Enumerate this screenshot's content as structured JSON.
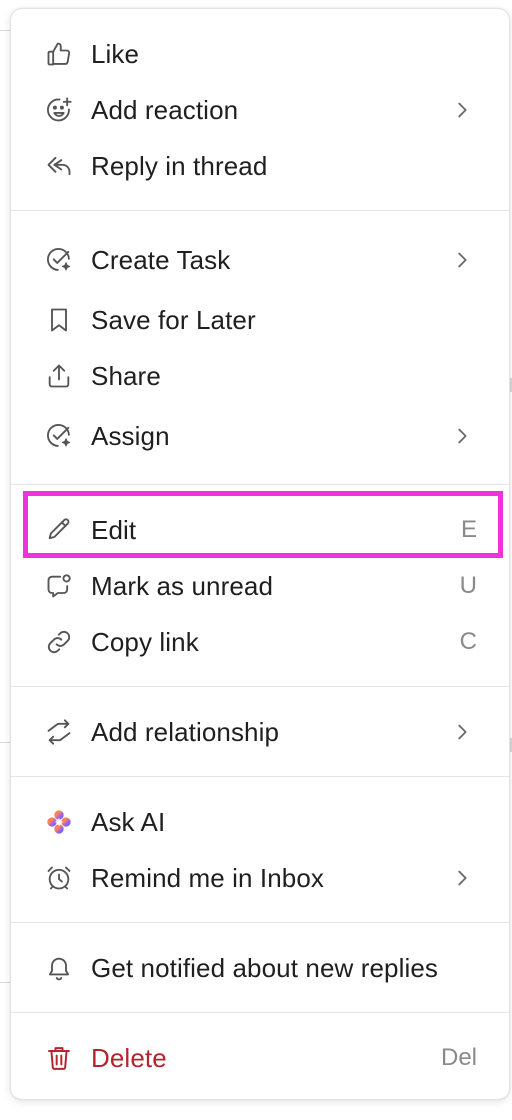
{
  "menu": {
    "items": [
      {
        "id": "like",
        "label": "Like",
        "icon": "thumbs-up-icon",
        "submenu": false,
        "shortcut": ""
      },
      {
        "id": "add-reaction",
        "label": "Add reaction",
        "icon": "emoji-add-icon",
        "submenu": true,
        "shortcut": ""
      },
      {
        "id": "reply-in-thread",
        "label": "Reply in thread",
        "icon": "reply-icon",
        "submenu": false,
        "shortcut": ""
      },
      {
        "id": "create-task",
        "label": "Create Task",
        "icon": "task-check-icon",
        "submenu": true,
        "shortcut": ""
      },
      {
        "id": "save-for-later",
        "label": "Save for Later",
        "icon": "bookmark-icon",
        "submenu": false,
        "shortcut": ""
      },
      {
        "id": "share",
        "label": "Share",
        "icon": "share-upload-icon",
        "submenu": false,
        "shortcut": ""
      },
      {
        "id": "assign",
        "label": "Assign",
        "icon": "assign-check-icon",
        "submenu": true,
        "shortcut": ""
      },
      {
        "id": "edit",
        "label": "Edit",
        "icon": "pencil-icon",
        "submenu": false,
        "shortcut": "E"
      },
      {
        "id": "mark-as-unread",
        "label": "Mark as unread",
        "icon": "unread-bubble-icon",
        "submenu": false,
        "shortcut": "U"
      },
      {
        "id": "copy-link",
        "label": "Copy link",
        "icon": "link-icon",
        "submenu": false,
        "shortcut": "C"
      },
      {
        "id": "add-relationship",
        "label": "Add relationship",
        "icon": "relationship-arrows-icon",
        "submenu": true,
        "shortcut": ""
      },
      {
        "id": "ask-ai",
        "label": "Ask AI",
        "icon": "ai-sparkle-icon",
        "submenu": false,
        "shortcut": ""
      },
      {
        "id": "remind-me-in-inbox",
        "label": "Remind me in Inbox",
        "icon": "alarm-clock-icon",
        "submenu": true,
        "shortcut": ""
      },
      {
        "id": "get-notified",
        "label": "Get notified about new replies",
        "icon": "bell-icon",
        "submenu": false,
        "shortcut": ""
      },
      {
        "id": "delete",
        "label": "Delete",
        "icon": "trash-icon",
        "submenu": false,
        "shortcut": "Del",
        "danger": true
      }
    ]
  },
  "colors": {
    "text": "#1f1f1f",
    "icon": "#555555",
    "shortcut": "#8a8a8a",
    "danger": "#b3262e",
    "highlight": "#ee33dd"
  }
}
